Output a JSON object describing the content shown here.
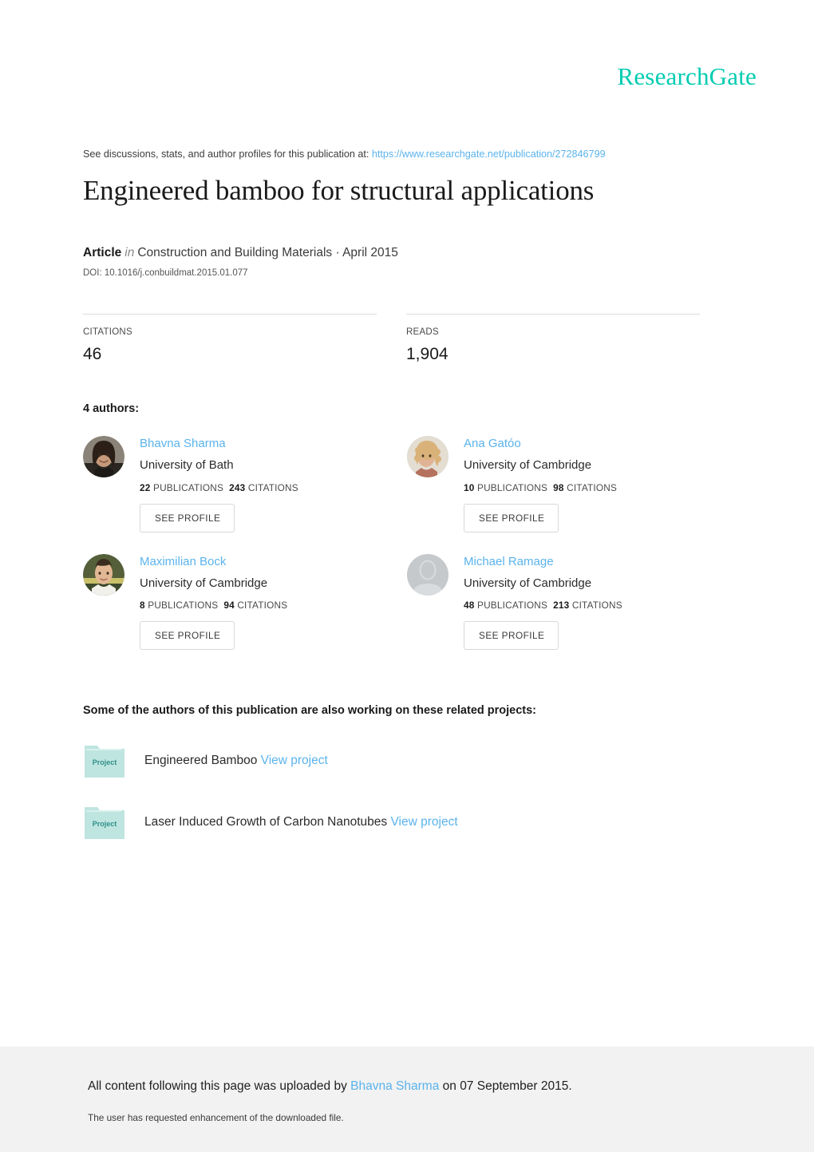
{
  "brand": {
    "name": "ResearchGate"
  },
  "header": {
    "discussion_prefix": "See discussions, stats, and author profiles for this publication at:",
    "publication_url": "https://www.researchgate.net/publication/272846799"
  },
  "publication": {
    "title": "Engineered bamboo for structural applications",
    "type_label": "Article",
    "in_label": "in",
    "venue": "Construction and Building Materials · April 2015",
    "doi": "DOI: 10.1016/j.conbuildmat.2015.01.077"
  },
  "stats": [
    {
      "label": "CITATIONS",
      "value": "46"
    },
    {
      "label": "READS",
      "value": "1,904"
    }
  ],
  "authors_section": {
    "heading": "4 authors:",
    "see_profile_label": "SEE PROFILE",
    "publications_label": "PUBLICATIONS",
    "citations_label": "CITATIONS"
  },
  "authors": [
    {
      "name": "Bhavna Sharma",
      "affiliation": "University of Bath",
      "publications": "22",
      "citations": "243",
      "avatar": "photo-female-dark-hair"
    },
    {
      "name": "Ana Gatóo",
      "affiliation": "University of Cambridge",
      "publications": "10",
      "citations": "98",
      "avatar": "photo-female-curly-hair"
    },
    {
      "name": "Maximilian Bock",
      "affiliation": "University of Cambridge",
      "publications": "8",
      "citations": "94",
      "avatar": "photo-male-outdoors"
    },
    {
      "name": "Michael Ramage",
      "affiliation": "University of Cambridge",
      "publications": "48",
      "citations": "213",
      "avatar": "placeholder-person-silhouette"
    }
  ],
  "projects_section": {
    "heading": "Some of the authors of this publication are also working on these related projects:",
    "folder_icon_label": "Project",
    "view_label": "View project"
  },
  "projects": [
    {
      "title": "Engineered Bamboo"
    },
    {
      "title": "Laser Induced Growth of Carbon Nanotubes"
    }
  ],
  "footer": {
    "upload_prefix": "All content following this page was uploaded by",
    "uploader": "Bhavna Sharma",
    "upload_suffix": "on 07 September 2015.",
    "enhancement_note": "The user has requested enhancement of the downloaded file."
  },
  "colors": {
    "brand_teal": "#00ccb1",
    "link_blue": "#5bb3ec",
    "folder_mint": "#bfe5e0",
    "footer_gray": "#f2f2f2"
  }
}
